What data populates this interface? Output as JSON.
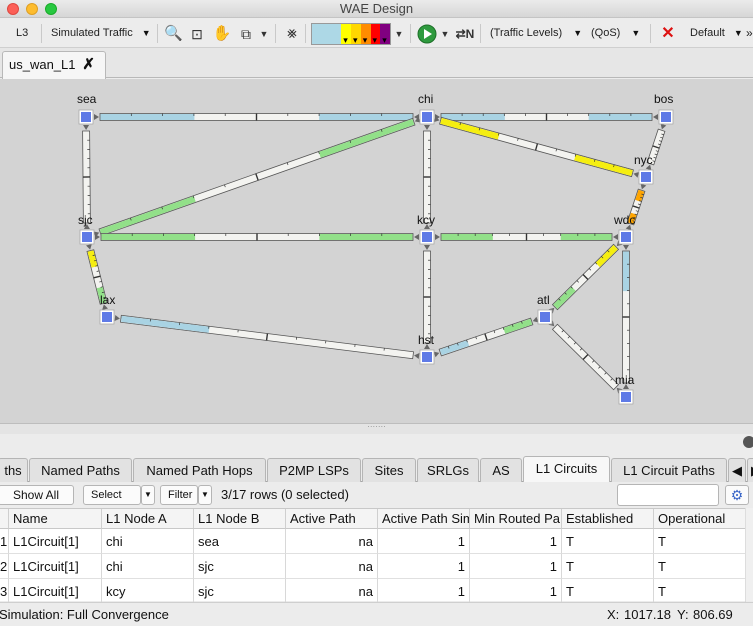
{
  "window": {
    "title": "WAE Design"
  },
  "toolbar": {
    "layer": "L3",
    "traffic_select": "Simulated Traffic",
    "traffic_levels": "(Traffic Levels)",
    "qos": "(QoS)",
    "default_select": "Default",
    "overflow": "»",
    "utilization_colors": [
      "#add8e6",
      "#ffff00",
      "#ffd700",
      "#ff8c00",
      "#ff0000",
      "#800080"
    ]
  },
  "document_tab": {
    "label": "us_wan_L1"
  },
  "nodes": [
    {
      "name": "sea"
    },
    {
      "name": "chi"
    },
    {
      "name": "bos"
    },
    {
      "name": "nyc"
    },
    {
      "name": "sjc"
    },
    {
      "name": "kcy"
    },
    {
      "name": "wdc"
    },
    {
      "name": "lax"
    },
    {
      "name": "atl"
    },
    {
      "name": "hst"
    },
    {
      "name": "mia"
    }
  ],
  "bottom_tabs": [
    "ths",
    "Named Paths",
    "Named Path Hops",
    "P2MP LSPs",
    "Sites",
    "SRLGs",
    "AS",
    "L1 Circuits",
    "L1 Circuit Paths"
  ],
  "active_bottom_tab": "L1 Circuits",
  "filter_bar": {
    "show_all": "Show All",
    "select_all": "Select All",
    "filter": "Filter",
    "row_info": "3/17 rows (0 selected)",
    "search_value": ""
  },
  "table": {
    "columns": [
      "",
      "Name",
      "L1 Node A",
      "L1 Node B",
      "Active Path",
      "Active Path Sim",
      "Min Routed Pa",
      "Established",
      "Operational"
    ],
    "rows": [
      [
        "1",
        "L1Circuit[1]",
        "chi",
        "sea",
        "na",
        "1",
        "1",
        "T",
        "T"
      ],
      [
        "2",
        "L1Circuit[1]",
        "chi",
        "sjc",
        "na",
        "1",
        "1",
        "T",
        "T"
      ],
      [
        "3",
        "L1Circuit[1]",
        "kcy",
        "sjc",
        "na",
        "1",
        "1",
        "T",
        "T"
      ]
    ]
  },
  "status": {
    "simulation": "Simulation: Full Convergence",
    "x_label": "X:",
    "x": "1017.18",
    "y_label": "Y:",
    "y": "806.69"
  }
}
